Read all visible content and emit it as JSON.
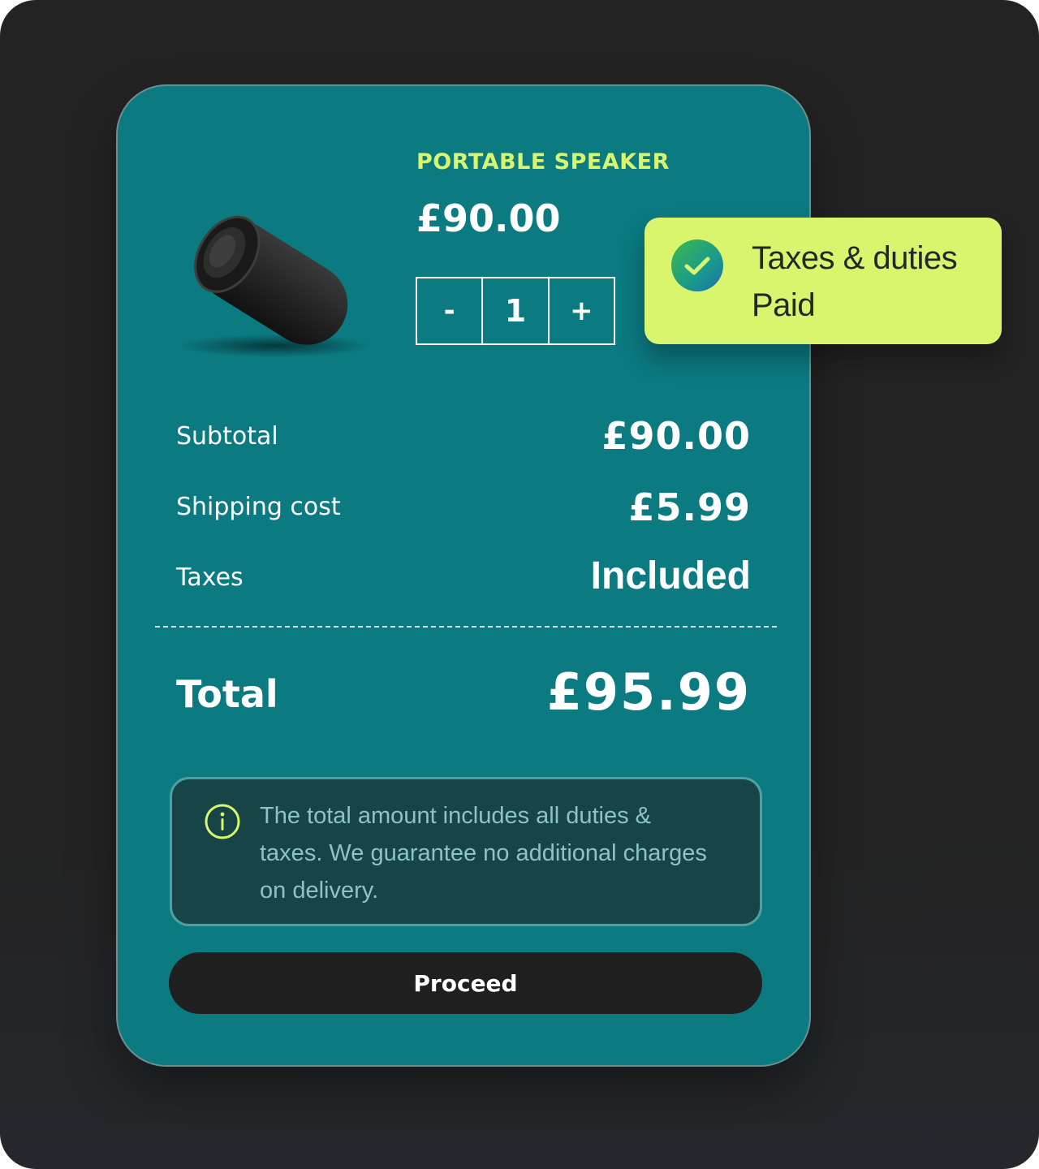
{
  "product": {
    "name": "PORTABLE SPEAKER",
    "price": "£90.00",
    "image_icon": "speaker-image"
  },
  "quantity": {
    "decrement_label": "-",
    "value": "1",
    "increment_label": "+"
  },
  "summary": {
    "subtotal_label": "Subtotal",
    "subtotal_value": "£90.00",
    "shipping_label": "Shipping cost",
    "shipping_value": "£5.99",
    "taxes_label": "Taxes",
    "taxes_value": "Included",
    "total_label": "Total",
    "total_value": "£95.99"
  },
  "info": {
    "icon": "info-icon",
    "text": "The total amount includes all duties & taxes. We guarantee no additional charges on delivery."
  },
  "actions": {
    "proceed_label": "Proceed"
  },
  "badge": {
    "icon": "check-circle-icon",
    "line1": "Taxes & duties",
    "line2": "Paid"
  },
  "colors": {
    "card_bg": "#0b7a81",
    "accent_lime": "#d8f56d",
    "page_bg": "#232323",
    "info_bg": "#174446",
    "button_bg": "#1f1f1f"
  }
}
